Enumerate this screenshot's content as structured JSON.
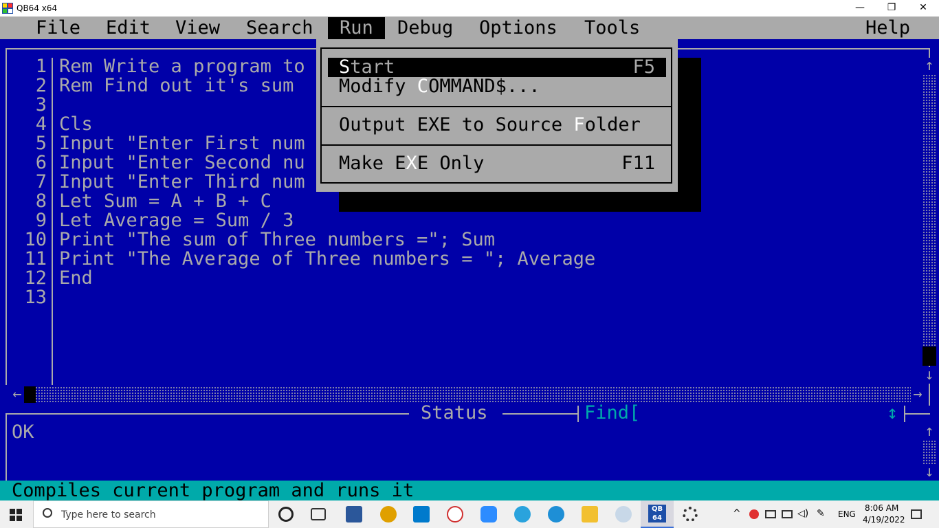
{
  "window": {
    "title": "QB64 x64",
    "minimize_glyph": "—",
    "restore_glyph": "❐",
    "close_glyph": "✕"
  },
  "menubar": {
    "items": [
      "File",
      "Edit",
      "View",
      "Search",
      "Run",
      "Debug",
      "Options",
      "Tools"
    ],
    "help": "Help",
    "active": "Run"
  },
  "editor": {
    "line_numbers": [
      "1",
      "2",
      "3",
      "4",
      "5",
      "6",
      "7",
      "8",
      "9",
      "10",
      "11",
      "12",
      "13"
    ],
    "lines": [
      "Rem Write a program to",
      "Rem Find out it's sum",
      "",
      "Cls",
      "Input \"Enter First num",
      "Input \"Enter Second nu",
      "Input \"Enter Third num",
      "Let Sum = A + B + C",
      "Let Average = Sum / 3",
      "Print \"The sum of Three numbers =\"; Sum",
      "Print \"The Average of Three numbers = \"; Average",
      "End",
      ""
    ]
  },
  "run_menu": {
    "start": {
      "pre": "",
      "hotkey": "S",
      "post": "tart",
      "shortcut": "F5"
    },
    "modify": {
      "pre": "Modify ",
      "hotkey": "C",
      "post": "OMMAND$..."
    },
    "output": {
      "pre": "Output EXE to Source ",
      "hotkey": "F",
      "post": "older"
    },
    "make": {
      "pre": "Make E",
      "hotkey": "X",
      "post": "E Only",
      "shortcut": "F11"
    }
  },
  "status_panel": {
    "title": "Status",
    "find_label": "Find[",
    "message": "OK",
    "resize_glyph": "↕"
  },
  "statusbar": {
    "text": "Compiles current program and runs it"
  },
  "taskbar": {
    "search_placeholder": "Type here to search",
    "language": "ENG",
    "time": "8:06 AM",
    "date": "4/19/2022",
    "qb64_label": "QB 64"
  },
  "colors": {
    "qb_blue": "#0000a8",
    "qb_gray": "#aaaaaa",
    "qb_cyan": "#00aaaa"
  }
}
